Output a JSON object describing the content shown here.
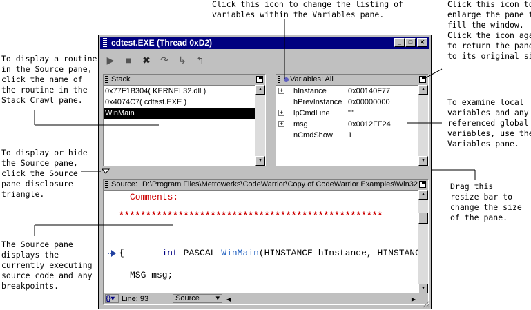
{
  "annotations": {
    "change_listing": "Click this icon to change the listing of\nvariables within the Variables pane.",
    "enlarge_pane": "Click this icon to\nenlarge the pane to\nfill the window.\nClick the icon again\nto return the pane\nto its original size.",
    "display_routine": "To display a routine\nin the Source pane,\nclick the name of\nthe routine in the\nStack Crawl pane.",
    "examine_vars": "To examine local\nvariables and any\nreferenced global\nvariables, use the\nVariables pane.",
    "display_hide_source": "To display or hide\nthe Source pane,\nclick the Source\npane disclosure\ntriangle.",
    "drag_resize": "Drag this\nresize bar to\nchange the size\nof the pane.",
    "source_pane_desc": "The Source pane\ndisplays the\ncurrently executing\nsource code and any\nbreakpoints."
  },
  "window": {
    "title": "cdtest.EXE (Thread 0xD2)",
    "minimize": "_",
    "maximize": "□",
    "close": "✕"
  },
  "toolbar": {
    "run": "▶",
    "stop": "■",
    "kill": "✖",
    "step_over": "↷",
    "step_into": "↳",
    "step_out": "↰"
  },
  "stack": {
    "title": "Stack",
    "items": [
      "0x77F1B304( KERNEL32.dll )",
      "0x4074C7( cdtest.EXE )",
      "WinMain"
    ]
  },
  "variables": {
    "title": "Variables: All",
    "rows": [
      {
        "name": "hInstance",
        "value": "0x00140F77",
        "expand": "+"
      },
      {
        "name": "hPrevInstance",
        "value": "0x00000000",
        "expand": ""
      },
      {
        "name": "lpCmdLine",
        "value": "\"\"",
        "expand": "+"
      },
      {
        "name": "msg",
        "value": "0x0012FF24",
        "expand": "+"
      },
      {
        "name": "nCmdShow",
        "value": "1",
        "expand": ""
      }
    ]
  },
  "source": {
    "label": "Source:",
    "path": "D:\\Program Files\\Metrowerks\\CodeWarrior\\Copy of CodeWarrior Examples\\Win32",
    "comments": "Comments:",
    "stars": "*************************************************",
    "line_int": "int",
    "line_pascal": "PASCAL",
    "line_winmain": "WinMain",
    "line_rest": "(HINSTANCE hInstance, HINSTANCE hPre",
    "brace": "{",
    "msg_line": "MSG msg;",
    "status_funcs": "{}",
    "status_line": "Line: 93",
    "status_mode": "Source"
  },
  "colors": {
    "title_bar": "#000080",
    "comment": "#cc0000",
    "keyword": "#000080",
    "function": "#2060c0"
  }
}
